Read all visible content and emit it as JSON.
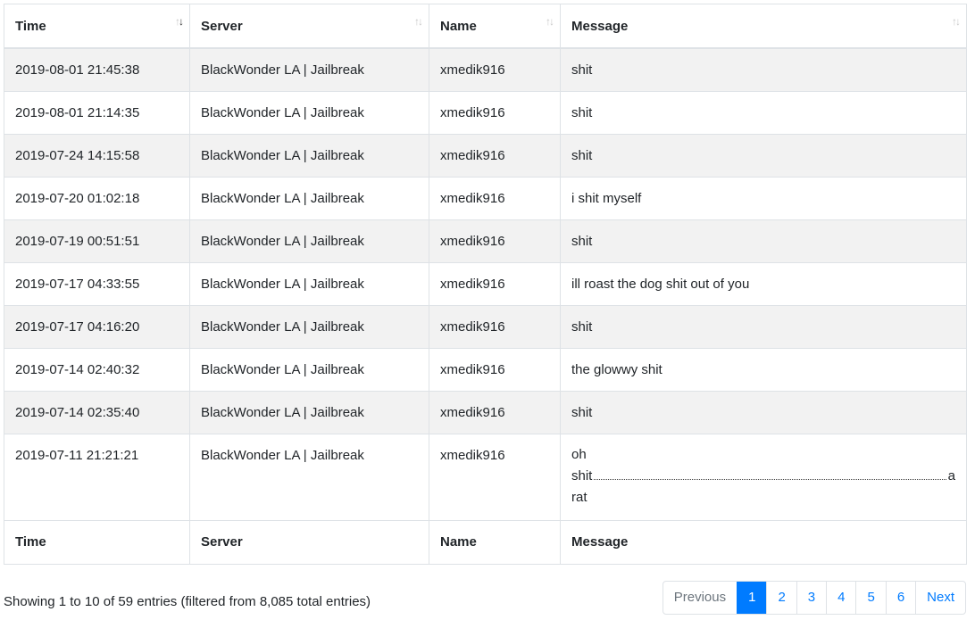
{
  "columns": [
    "Time",
    "Server",
    "Name",
    "Message"
  ],
  "rows": [
    {
      "time": "2019-08-01 21:45:38",
      "server": "BlackWonder LA | Jailbreak",
      "name": "xmedik916",
      "message": "shit"
    },
    {
      "time": "2019-08-01 21:14:35",
      "server": "BlackWonder LA | Jailbreak",
      "name": "xmedik916",
      "message": "shit"
    },
    {
      "time": "2019-07-24 14:15:58",
      "server": "BlackWonder LA | Jailbreak",
      "name": "xmedik916",
      "message": "shit"
    },
    {
      "time": "2019-07-20 01:02:18",
      "server": "BlackWonder LA | Jailbreak",
      "name": "xmedik916",
      "message": "i shit myself"
    },
    {
      "time": "2019-07-19 00:51:51",
      "server": "BlackWonder LA | Jailbreak",
      "name": "xmedik916",
      "message": "shit"
    },
    {
      "time": "2019-07-17 04:33:55",
      "server": "BlackWonder LA | Jailbreak",
      "name": "xmedik916",
      "message": "ill roast the dog shit out of you"
    },
    {
      "time": "2019-07-17 04:16:20",
      "server": "BlackWonder LA | Jailbreak",
      "name": "xmedik916",
      "message": "shit"
    },
    {
      "time": "2019-07-14 02:40:32",
      "server": "BlackWonder LA | Jailbreak",
      "name": "xmedik916",
      "message": "the glowwy shit"
    },
    {
      "time": "2019-07-14 02:35:40",
      "server": "BlackWonder LA | Jailbreak",
      "name": "xmedik916",
      "message": "shit"
    },
    {
      "time": "2019-07-11 21:21:21",
      "server": "BlackWonder LA | Jailbreak",
      "name": "xmedik916",
      "message_lines": [
        "oh",
        "shit",
        "a",
        "rat"
      ]
    }
  ],
  "info": "Showing 1 to 10 of 59 entries (filtered from 8,085 total entries)",
  "pagination": {
    "previous": "Previous",
    "pages": [
      "1",
      "2",
      "3",
      "4",
      "5",
      "6"
    ],
    "next": "Next"
  },
  "sort_glyphs": {
    "up": "↑",
    "down": "↓"
  },
  "colors": {
    "accent": "#007bff",
    "stripe": "#f2f2f2",
    "border": "#dee2e6"
  }
}
